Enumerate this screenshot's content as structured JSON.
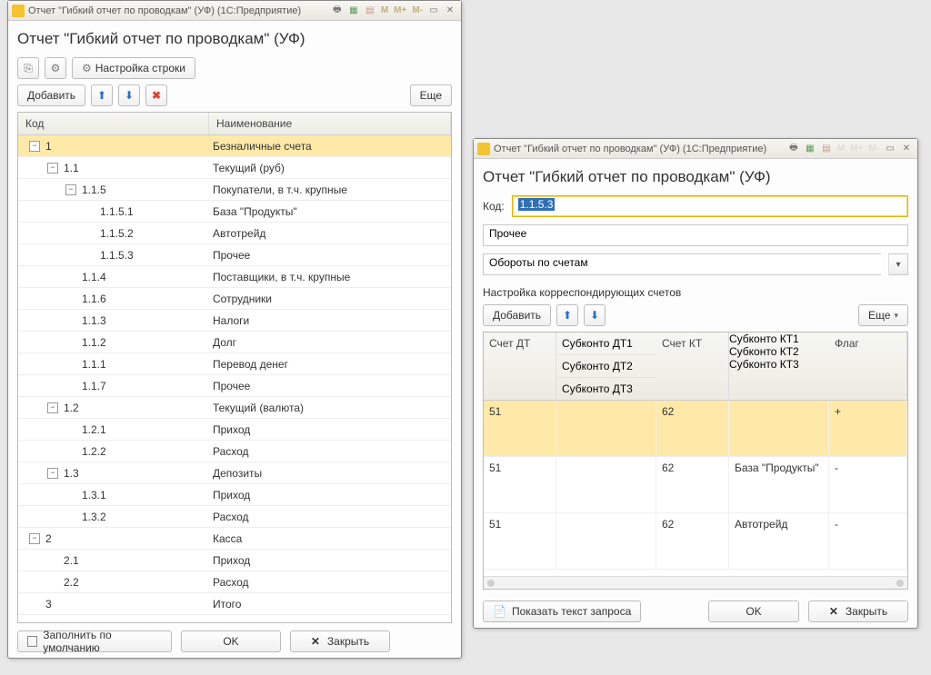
{
  "win1": {
    "titlebar": "Отчет \"Гибкий отчет по проводкам\" (УФ)  (1С:Предприятие)",
    "heading": "Отчет \"Гибкий отчет по проводкам\" (УФ)",
    "settings_btn": "Настройка строки",
    "add_btn": "Добавить",
    "more_btn": "Еще",
    "columns": {
      "code": "Код",
      "name": "Наименование"
    },
    "rows": [
      {
        "lvl": 0,
        "tgl": "-",
        "code": "1",
        "name": "Безналичные счета",
        "sel": true
      },
      {
        "lvl": 1,
        "tgl": "-",
        "code": "1.1",
        "name": "Текущий (руб)"
      },
      {
        "lvl": 2,
        "tgl": "-",
        "code": "1.1.5",
        "name": "Покупатели, в т.ч. крупные"
      },
      {
        "lvl": 3,
        "tgl": "",
        "code": "1.1.5.1",
        "name": "База \"Продукты\""
      },
      {
        "lvl": 3,
        "tgl": "",
        "code": "1.1.5.2",
        "name": "Автотрейд"
      },
      {
        "lvl": 3,
        "tgl": "",
        "code": "1.1.5.3",
        "name": "Прочее"
      },
      {
        "lvl": 2,
        "tgl": "",
        "code": "1.1.4",
        "name": "Поставщики, в т.ч. крупные"
      },
      {
        "lvl": 2,
        "tgl": "",
        "code": "1.1.6",
        "name": "Сотрудники"
      },
      {
        "lvl": 2,
        "tgl": "",
        "code": "1.1.3",
        "name": "Налоги"
      },
      {
        "lvl": 2,
        "tgl": "",
        "code": "1.1.2",
        "name": "Долг"
      },
      {
        "lvl": 2,
        "tgl": "",
        "code": "1.1.1",
        "name": "Перевод денег"
      },
      {
        "lvl": 2,
        "tgl": "",
        "code": "1.1.7",
        "name": "Прочее"
      },
      {
        "lvl": 1,
        "tgl": "-",
        "code": "1.2",
        "name": "Текущий (валюта)"
      },
      {
        "lvl": 2,
        "tgl": "",
        "code": "1.2.1",
        "name": "Приход"
      },
      {
        "lvl": 2,
        "tgl": "",
        "code": "1.2.2",
        "name": "Расход"
      },
      {
        "lvl": 1,
        "tgl": "-",
        "code": "1.3",
        "name": "Депозиты"
      },
      {
        "lvl": 2,
        "tgl": "",
        "code": "1.3.1",
        "name": "Приход"
      },
      {
        "lvl": 2,
        "tgl": "",
        "code": "1.3.2",
        "name": "Расход"
      },
      {
        "lvl": 0,
        "tgl": "-",
        "code": "2",
        "name": "Касса"
      },
      {
        "lvl": 1,
        "tgl": "",
        "code": "2.1",
        "name": "Приход"
      },
      {
        "lvl": 1,
        "tgl": "",
        "code": "2.2",
        "name": "Расход"
      },
      {
        "lvl": 0,
        "tgl": "",
        "code": "3",
        "name": "Итого"
      }
    ],
    "footer": {
      "defaults": "Заполнить по умолчанию",
      "ok": "OK",
      "close": "Закрыть"
    }
  },
  "win2": {
    "titlebar": "Отчет \"Гибкий отчет по проводкам\" (УФ)  (1С:Предприятие)",
    "heading": "Отчет \"Гибкий отчет по проводкам\" (УФ)",
    "code_label": "Код:",
    "code_value": "1.1.5.3",
    "name_value": "Прочее",
    "combo_value": "Обороты по счетам",
    "section": "Настройка корреспондирующих счетов",
    "add_btn": "Добавить",
    "more_btn": "Еще",
    "head": {
      "c1": "Счет ДТ",
      "c2a": "Субконто ДТ1",
      "c2b": "Субконто ДТ2",
      "c2c": "Субконто ДТ3",
      "c3": "Счет КТ",
      "c4a": "Субконто КТ1",
      "c4b": "Субконто КТ2",
      "c4c": "Субконто КТ3",
      "c5": "Флаг"
    },
    "rows": [
      {
        "dt": "51",
        "sdt": "",
        "kt": "62",
        "skt": "",
        "flag": "+",
        "sel": true
      },
      {
        "dt": "51",
        "sdt": "",
        "kt": "62",
        "skt": "База \"Продукты\"",
        "flag": "-"
      },
      {
        "dt": "51",
        "sdt": "",
        "kt": "62",
        "skt": "Автотрейд",
        "flag": "-"
      }
    ],
    "footer": {
      "query": "Показать текст запроса",
      "ok": "OK",
      "close": "Закрыть"
    }
  },
  "mem_btns": [
    "M",
    "M+",
    "M-"
  ]
}
